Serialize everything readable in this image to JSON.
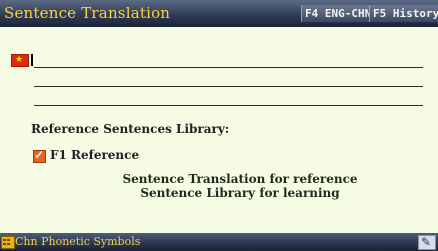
{
  "titlebar": {
    "title": "Sentence Translation",
    "f4_label": "F4 ENG-CHN",
    "f5_label": "F5 History"
  },
  "input": {
    "language_icon": "chinese-flag-icon",
    "text": ""
  },
  "library": {
    "heading": "Reference Sentences Library:",
    "option_label": "F1 Reference",
    "option_checked": true,
    "description_line1": "Sentence Translation for reference",
    "description_line2": "Sentence Library for learning"
  },
  "statusbar": {
    "text": "Chn Phonetic Symbols",
    "left_icon": "keyboard-icon",
    "right_icon": "pen-icon"
  },
  "colors": {
    "title_text": "#ffd23a",
    "background": "#f6fbe4",
    "bar": "#2f3c55",
    "checkbox": "#e8651e"
  }
}
